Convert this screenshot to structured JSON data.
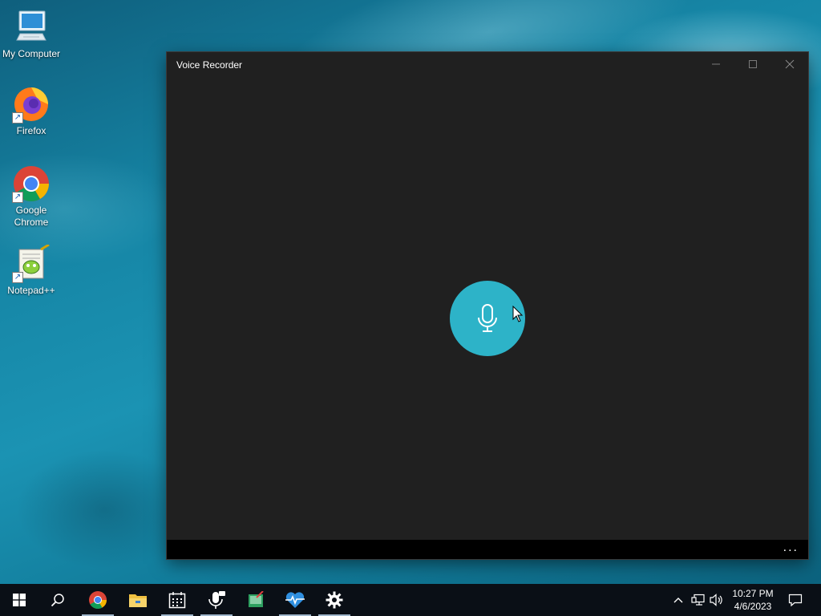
{
  "desktop": {
    "icons": [
      {
        "label": "My Computer",
        "icon": "computer-icon"
      },
      {
        "label": "Firefox",
        "icon": "firefox-icon"
      },
      {
        "label": "Google Chrome",
        "icon": "chrome-icon"
      },
      {
        "label": "Notepad++",
        "icon": "notepadpp-icon"
      }
    ]
  },
  "window": {
    "title": "Voice Recorder",
    "controls": {
      "minimize": "minimize-icon",
      "maximize": "maximize-icon",
      "close": "close-icon"
    },
    "record_button": {
      "icon": "microphone-icon",
      "color": "#2db3c8"
    },
    "more_label": "..."
  },
  "taskbar": {
    "apps": [
      {
        "name": "Start",
        "icon": "windows-start-icon"
      },
      {
        "name": "Search",
        "icon": "search-icon"
      },
      {
        "name": "Google Chrome",
        "icon": "chrome-icon"
      },
      {
        "name": "File Explorer",
        "icon": "folder-icon"
      },
      {
        "name": "Calendar",
        "icon": "calendar-icon"
      },
      {
        "name": "Voice Recorder",
        "icon": "microphone-icon"
      },
      {
        "name": "Notepad++",
        "icon": "notepadpp-icon"
      },
      {
        "name": "Health",
        "icon": "heart-pulse-icon"
      },
      {
        "name": "Settings",
        "icon": "gear-icon"
      }
    ],
    "tray": {
      "icons": [
        "chevron-up-icon",
        "network-icon",
        "volume-icon"
      ],
      "time": "10:27 PM",
      "date": "4/6/2023",
      "notification_icon": "notification-icon"
    }
  }
}
